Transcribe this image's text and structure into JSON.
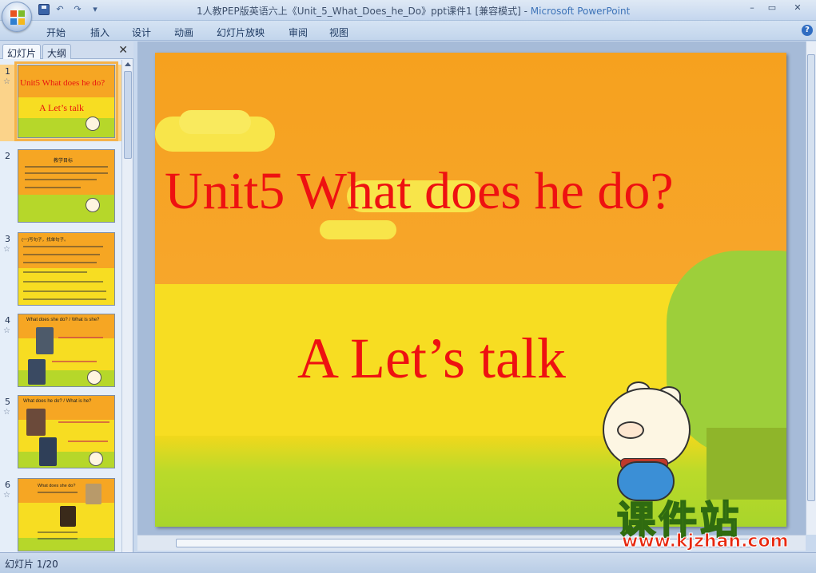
{
  "window": {
    "title": "1人教PEP版英语六上《Unit_5_What_Does_he_Do》ppt课件1 [兼容模式] - ",
    "app_name": "Microsoft PowerPoint"
  },
  "qat": {
    "undo": "↶",
    "redo": "↷",
    "dropdown": "▾"
  },
  "window_controls": {
    "minimize": "–",
    "restore": "▭",
    "close": "✕"
  },
  "ribbon": {
    "tabs": [
      "开始",
      "插入",
      "设计",
      "动画",
      "幻灯片放映",
      "审阅",
      "视图"
    ],
    "help": "?"
  },
  "panel": {
    "tab_slides": "幻灯片",
    "tab_outline": "大纲",
    "close": "✕"
  },
  "thumbnails": [
    {
      "num": "1",
      "star": "☆",
      "title": "Unit5 What does he do?",
      "sub": "A Let’s talk"
    },
    {
      "num": "2",
      "star": "☆",
      "title": "教学目标"
    },
    {
      "num": "3",
      "star": "☆",
      "title": "(一)写句子，找单句子。"
    },
    {
      "num": "4",
      "star": "☆",
      "title": "What does she do? / What is she?"
    },
    {
      "num": "5",
      "star": "☆",
      "title": "What does he do? / What is he?"
    },
    {
      "num": "6",
      "star": "☆",
      "title": "What does she do?"
    }
  ],
  "slide": {
    "title": "Unit5  What does he do?",
    "subtitle": "A Let’s talk"
  },
  "status": {
    "text": "幻灯片 1/20"
  },
  "watermark": {
    "cn": "课件站",
    "url": "www.kjzhan.com"
  }
}
